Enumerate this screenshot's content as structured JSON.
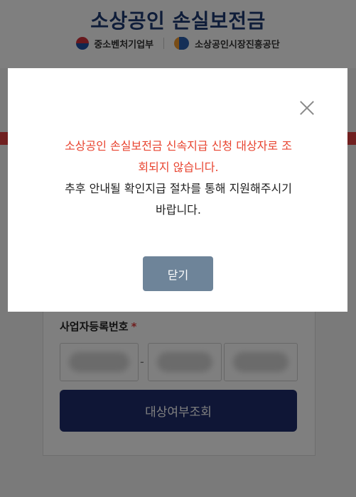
{
  "header": {
    "title": "소상공인 손실보전금",
    "logos": [
      {
        "icon": "taeguk-icon",
        "label": "중소벤처기업부"
      },
      {
        "icon": "semas-logo-icon",
        "label": "소상공인시장진흥공단"
      }
    ]
  },
  "form": {
    "biz_number_label": "사업자등록번호",
    "required_mark": "*",
    "fields": [
      {
        "value": ""
      },
      {
        "value": ""
      },
      {
        "value": ""
      }
    ],
    "separator": "-",
    "check_button": "대상여부조회"
  },
  "modal": {
    "message_red": [
      "소상공인 손실보전금 신속지급 신청 대상자로 조",
      "회되지 않습니다."
    ],
    "message_dark": [
      "추후 안내될 확인지급 절차를 통해 지원해주시기",
      "바랍니다."
    ],
    "close_button": "닫기",
    "close_icon": "close-icon"
  },
  "colors": {
    "title": "#1f3b73",
    "alert_red": "#e8432f",
    "primary_button": "#1e2c6c",
    "dialog_button": "#6e8499"
  }
}
